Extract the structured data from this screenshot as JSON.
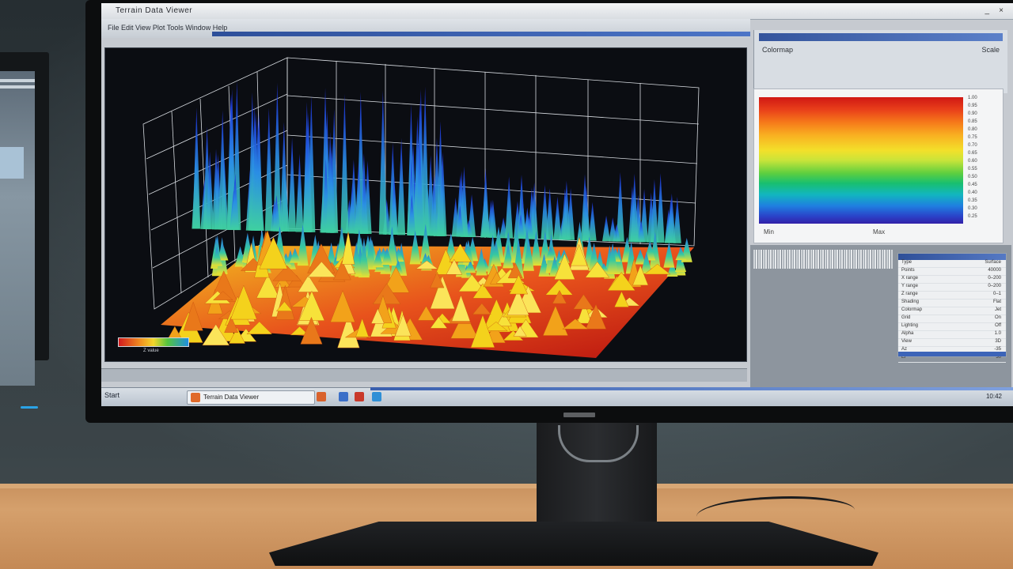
{
  "window": {
    "title": "Terrain Data Viewer",
    "minimize_label": "_",
    "close_label": "×"
  },
  "toolbar": {
    "text": "File  Edit  View  Plot  Tools  Window  Help"
  },
  "right_header": {
    "left_text": "Colormap",
    "right_text": "Scale"
  },
  "colorbar": {
    "ticks": [
      "1.00",
      "0.95",
      "0.90",
      "0.85",
      "0.80",
      "0.75",
      "0.70",
      "0.65",
      "0.60",
      "0.55",
      "0.50",
      "0.45",
      "0.40",
      "0.35",
      "0.30",
      "0.25"
    ],
    "min_label": "Min",
    "max_label": "Max",
    "colors": [
      "#d01814",
      "#f67a1a",
      "#f3e02a",
      "#5fcf3f",
      "#12b6bf",
      "#2a44c9"
    ]
  },
  "properties": {
    "rows": [
      {
        "label": "Type",
        "value": "Surface"
      },
      {
        "label": "Points",
        "value": "40000"
      },
      {
        "label": "X range",
        "value": "0–200"
      },
      {
        "label": "Y range",
        "value": "0–200"
      },
      {
        "label": "Z range",
        "value": "0–1"
      },
      {
        "label": "Shading",
        "value": "Flat"
      },
      {
        "label": "Colormap",
        "value": "Jet"
      },
      {
        "label": "Grid",
        "value": "On"
      },
      {
        "label": "Lighting",
        "value": "Off"
      },
      {
        "label": "Alpha",
        "value": "1.0"
      },
      {
        "label": "View",
        "value": "3D"
      },
      {
        "label": "Az",
        "value": "-35"
      },
      {
        "label": "El",
        "value": "30"
      }
    ]
  },
  "legend_chip_label": "Z value",
  "taskbar": {
    "start": "Start",
    "active_task": "Terrain Data Viewer",
    "clock": "10:42"
  }
}
